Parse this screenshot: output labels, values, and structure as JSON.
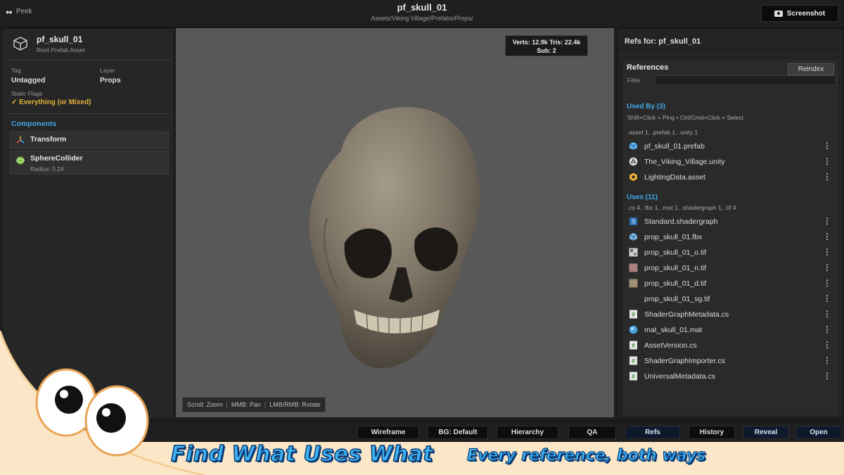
{
  "titlebar": {
    "app_name": "Peek",
    "title": "pf_skull_01",
    "path": "Assets/Viking Village/Prefabs/Props/",
    "screenshot_label": "Screenshot"
  },
  "inspector": {
    "asset_name": "pf_skull_01",
    "asset_type": "Root Prefab Asset",
    "tag_label": "Tag",
    "tag_value": "Untagged",
    "layer_label": "Layer",
    "layer_value": "Props",
    "static_flags_label": "Static Flags",
    "static_flags_value": "✓ Everything (or Mixed)",
    "components_title": "Components",
    "components": [
      {
        "name": "Transform",
        "sub": ""
      },
      {
        "name": "SphereCollider",
        "sub": "Radius: 0.24"
      }
    ]
  },
  "viewport": {
    "stats_line1": "Verts: 12.9k  Tris: 22.4k",
    "stats_line2": "Sub: 2",
    "hint_scroll": "Scroll: Zoom",
    "hint_mmb": "MMB: Pan",
    "hint_lmb": "LMB/RMB: Rotate"
  },
  "refs": {
    "header": "Refs for: pf_skull_01",
    "section_title": "References",
    "reindex_label": "Reindex",
    "filter_label": "Filter",
    "filter_value": "",
    "used_by_title": "Used By (3)",
    "used_by_hint": "Shift+Click = Ping  •  Ctrl/Cmd+Click = Select",
    "used_by_summary": ".asset 1, .prefab 1, .unity 1",
    "used_by": [
      {
        "name": "pf_skull_01.prefab",
        "icon": "prefab-icon"
      },
      {
        "name": "The_Viking_Village.unity",
        "icon": "unity-scene-icon"
      },
      {
        "name": "LightingData.asset",
        "icon": "lighting-asset-icon"
      }
    ],
    "uses_title": "Uses (11)",
    "uses_summary": ".cs 4, .fbx 1, .mat 1, .shadergraph 1, .tif 4",
    "uses": [
      {
        "name": "Standard.shadergraph",
        "icon": "shadergraph-icon"
      },
      {
        "name": "prop_skull_01.fbx",
        "icon": "model-icon"
      },
      {
        "name": "prop_skull_01_o.tif",
        "icon": "texture-o-icon"
      },
      {
        "name": "prop_skull_01_n.tif",
        "icon": "texture-n-icon"
      },
      {
        "name": "prop_skull_01_d.tif",
        "icon": "texture-d-icon"
      },
      {
        "name": "prop_skull_01_sg.tif",
        "icon": "texture-sg-icon"
      },
      {
        "name": "ShaderGraphMetadata.cs",
        "icon": "csharp-icon"
      },
      {
        "name": "mat_skull_01.mat",
        "icon": "material-icon"
      },
      {
        "name": "AssetVersion.cs",
        "icon": "csharp-icon"
      },
      {
        "name": "ShaderGraphImporter.cs",
        "icon": "csharp-icon"
      },
      {
        "name": "UniversalMetadata.cs",
        "icon": "csharp-icon"
      }
    ]
  },
  "toolbar": {
    "buttons": [
      "Wireframe",
      "BG: Default",
      "Hierarchy",
      "QA",
      "Refs",
      "History",
      "Reveal",
      "Open"
    ]
  },
  "banner": {
    "headline": "Find What Uses What",
    "tagline": "Every reference, both ways"
  },
  "colors": {
    "accent_blue": "#3fa9e8",
    "flag_yellow": "#e3b23c",
    "banner_bg": "#fbe7c7",
    "banner_text": "#3fb3f1"
  }
}
